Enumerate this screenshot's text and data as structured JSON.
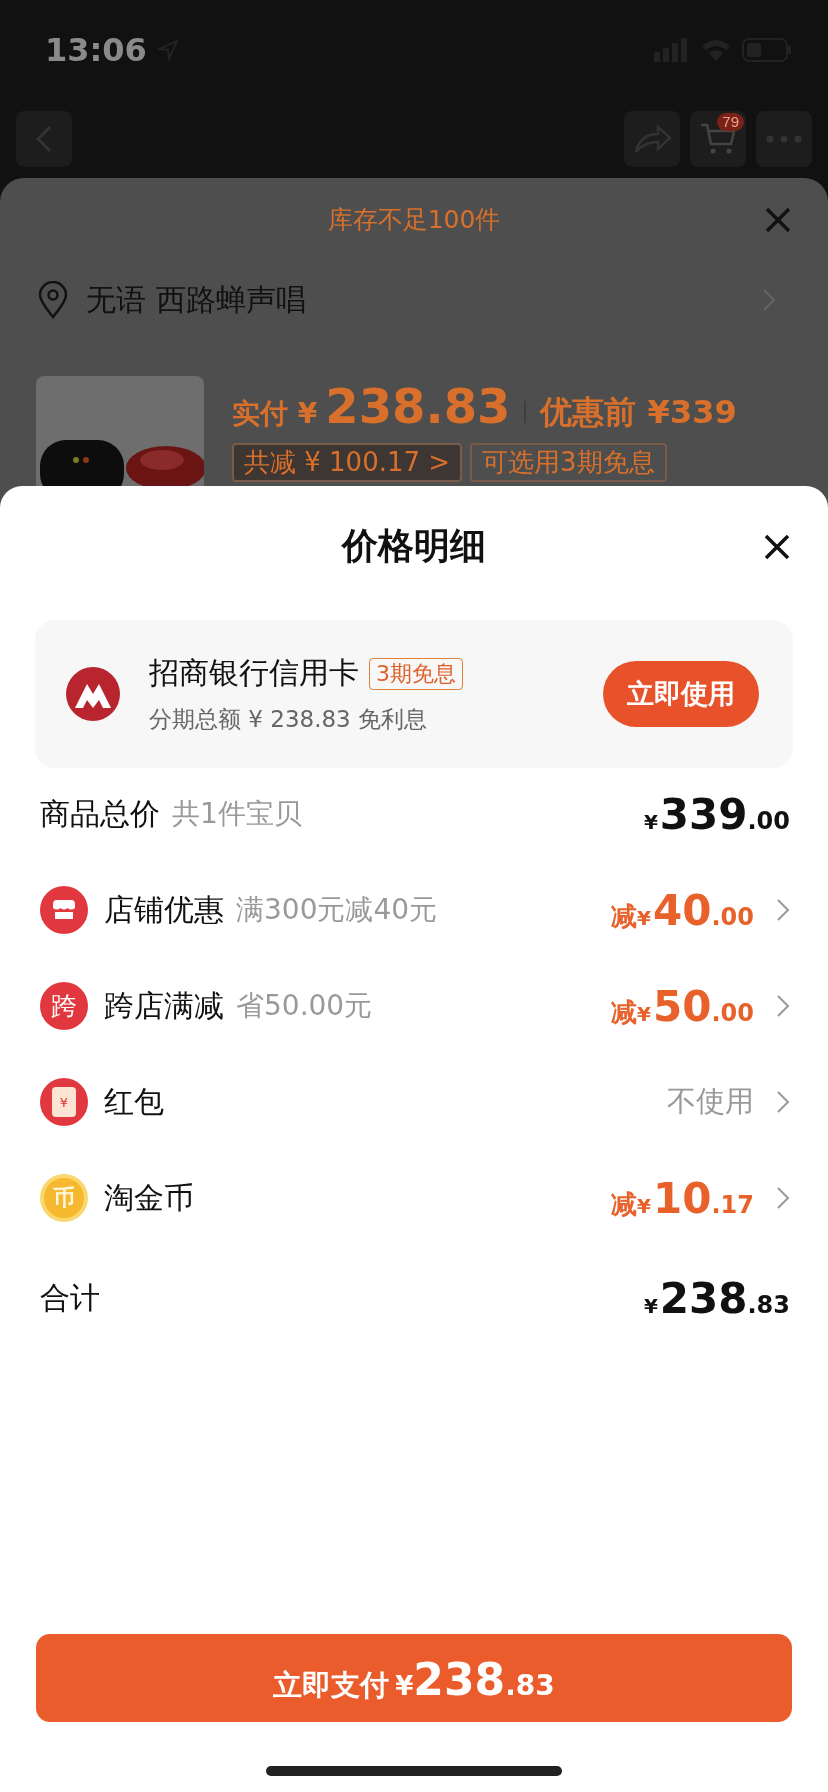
{
  "status_bar": {
    "time": "13:06"
  },
  "nav": {
    "cart_badge": "79"
  },
  "back_sheet": {
    "stock_notice": "库存不足100件",
    "address": "无语 西路蝉声唱",
    "product": {
      "pay_label": "实付 ¥",
      "pay_amount": "238.83",
      "original_label": "优惠前 ¥339",
      "tags": [
        "共减 ¥ 100.17 >",
        "可选用3期免息"
      ]
    }
  },
  "price_sheet": {
    "title": "价格明细",
    "card": {
      "bank": "招商银行信用卡",
      "tag": "3期免息",
      "subtitle": "分期总额 ¥ 238.83 免利息",
      "button": "立即使用"
    },
    "rows": [
      {
        "kind": "subtotal",
        "label": "商品总价",
        "note": "共1件宝贝",
        "value": {
          "symbol": "¥",
          "integer": "339",
          "decimal": ".00"
        },
        "chevron": false
      },
      {
        "kind": "store",
        "label": "店铺优惠",
        "note": "满300元减40元",
        "value": {
          "prefix": "减",
          "symbol": "¥",
          "integer": "40",
          "decimal": ".00"
        },
        "chevron": true
      },
      {
        "kind": "cross_store",
        "icon_text": "跨",
        "label": "跨店满减",
        "note": "省50.00元",
        "value": {
          "prefix": "减",
          "symbol": "¥",
          "integer": "50",
          "decimal": ".00"
        },
        "chevron": true
      },
      {
        "kind": "red_packet",
        "icon_text": "¥",
        "label": "红包",
        "value": {
          "text": "不使用"
        },
        "chevron": true
      },
      {
        "kind": "coins",
        "icon_text": "币",
        "label": "淘金币",
        "value": {
          "prefix": "减",
          "symbol": "¥",
          "integer": "10",
          "decimal": ".17"
        },
        "chevron": true
      },
      {
        "kind": "total",
        "label": "合计",
        "value": {
          "symbol": "¥",
          "integer": "238",
          "decimal": ".83"
        },
        "chevron": false
      }
    ],
    "pay_button": {
      "label": "立即支付",
      "symbol": "¥",
      "integer": "238",
      "decimal": ".83"
    }
  }
}
